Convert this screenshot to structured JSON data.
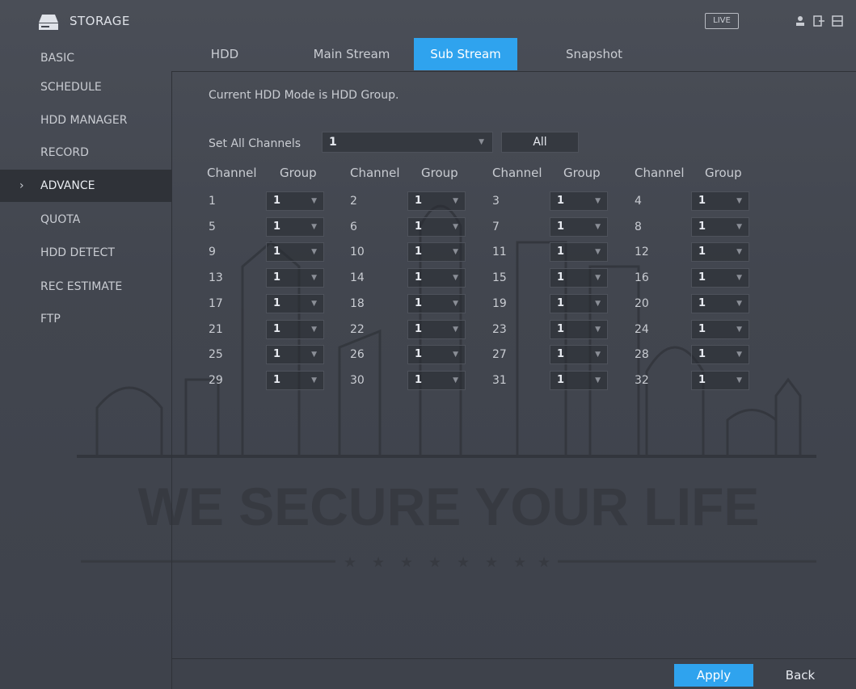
{
  "window": {
    "title": "STORAGE",
    "live_label": "LIVE",
    "icons": [
      "storage-icon",
      "user-icon",
      "logout-icon",
      "fullscreen-icon"
    ]
  },
  "sidebar": {
    "items": [
      {
        "label": "BASIC",
        "active": false
      },
      {
        "label": "SCHEDULE",
        "active": false
      },
      {
        "label": "HDD MANAGER",
        "active": false
      },
      {
        "label": "RECORD",
        "active": false
      },
      {
        "label": "ADVANCE",
        "active": true
      },
      {
        "label": "QUOTA",
        "active": false
      },
      {
        "label": "HDD DETECT",
        "active": false
      },
      {
        "label": "REC ESTIMATE",
        "active": false
      },
      {
        "label": "FTP",
        "active": false
      }
    ]
  },
  "tabs": [
    {
      "label": "HDD",
      "active": false
    },
    {
      "label": "Main Stream",
      "active": false
    },
    {
      "label": "Sub Stream",
      "active": true
    },
    {
      "label": "Snapshot",
      "active": false
    }
  ],
  "content": {
    "mode_text": "Current HDD Mode is HDD Group.",
    "set_all_label": "Set All Channels",
    "set_all_value": "1",
    "all_button": "All",
    "column_headers": {
      "channel": "Channel",
      "group": "Group"
    },
    "channels": [
      {
        "ch": "1",
        "group": "1"
      },
      {
        "ch": "2",
        "group": "1"
      },
      {
        "ch": "3",
        "group": "1"
      },
      {
        "ch": "4",
        "group": "1"
      },
      {
        "ch": "5",
        "group": "1"
      },
      {
        "ch": "6",
        "group": "1"
      },
      {
        "ch": "7",
        "group": "1"
      },
      {
        "ch": "8",
        "group": "1"
      },
      {
        "ch": "9",
        "group": "1"
      },
      {
        "ch": "10",
        "group": "1"
      },
      {
        "ch": "11",
        "group": "1"
      },
      {
        "ch": "12",
        "group": "1"
      },
      {
        "ch": "13",
        "group": "1"
      },
      {
        "ch": "14",
        "group": "1"
      },
      {
        "ch": "15",
        "group": "1"
      },
      {
        "ch": "16",
        "group": "1"
      },
      {
        "ch": "17",
        "group": "1"
      },
      {
        "ch": "18",
        "group": "1"
      },
      {
        "ch": "19",
        "group": "1"
      },
      {
        "ch": "20",
        "group": "1"
      },
      {
        "ch": "21",
        "group": "1"
      },
      {
        "ch": "22",
        "group": "1"
      },
      {
        "ch": "23",
        "group": "1"
      },
      {
        "ch": "24",
        "group": "1"
      },
      {
        "ch": "25",
        "group": "1"
      },
      {
        "ch": "26",
        "group": "1"
      },
      {
        "ch": "27",
        "group": "1"
      },
      {
        "ch": "28",
        "group": "1"
      },
      {
        "ch": "29",
        "group": "1"
      },
      {
        "ch": "30",
        "group": "1"
      },
      {
        "ch": "31",
        "group": "1"
      },
      {
        "ch": "32",
        "group": "1"
      }
    ]
  },
  "watermark": {
    "text": "WE SECURE YOUR LIFE"
  },
  "buttons": {
    "apply": "Apply",
    "back": "Back"
  },
  "colors": {
    "accent": "#2fa3ee",
    "background": "#42464f",
    "sidebar_active": "#2f3238"
  }
}
